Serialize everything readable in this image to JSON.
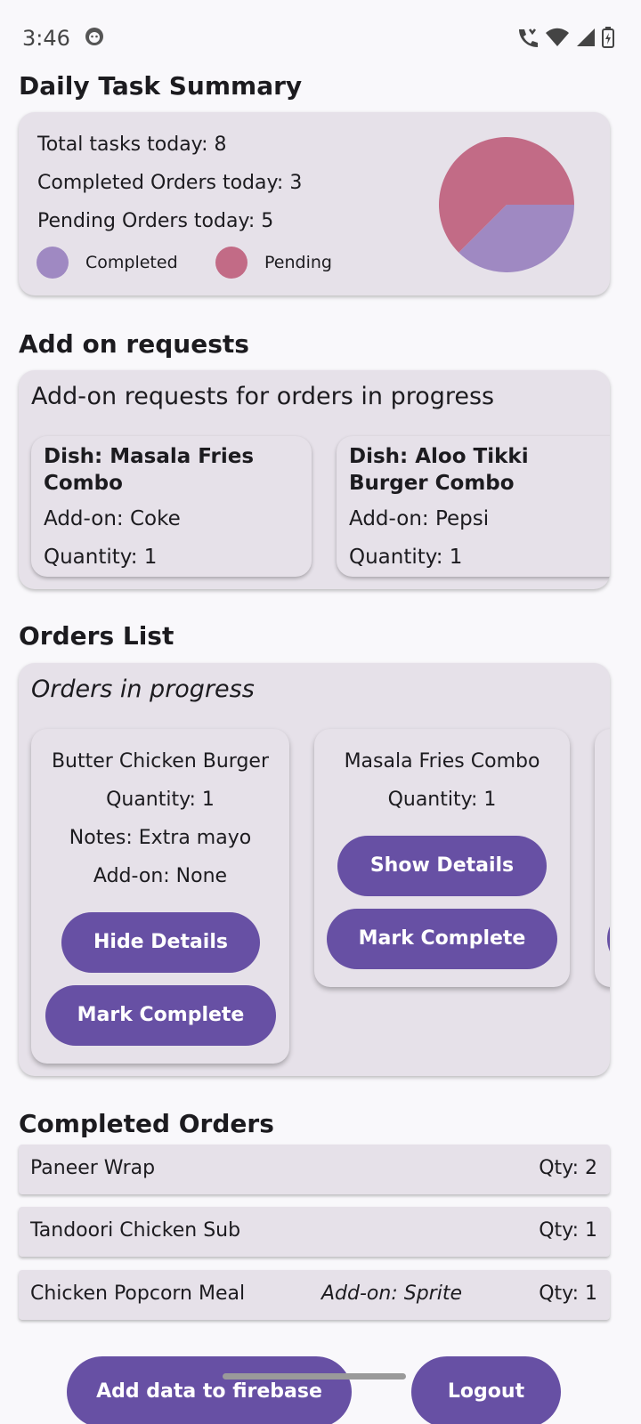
{
  "status_bar": {
    "time": "3:46"
  },
  "summary": {
    "title": "Daily Task Summary",
    "total": "Total tasks today: 8",
    "completed": "Completed Orders today: 3",
    "pending": "Pending Orders today: 5",
    "legend_completed": "Completed",
    "legend_pending": "Pending",
    "colors": {
      "completed": "#9f89c2",
      "pending": "#c26b86"
    }
  },
  "chart_data": {
    "type": "pie",
    "categories": [
      "Completed",
      "Pending"
    ],
    "values": [
      3,
      5
    ]
  },
  "addons": {
    "title": "Add on requests",
    "header": "Add-on requests for orders in progress",
    "items": [
      {
        "dish": "Dish: Masala Fries Combo",
        "addon": "Add-on: Coke",
        "qty": "Quantity: 1"
      },
      {
        "dish": "Dish: Aloo Tikki Burger Combo",
        "addon": "Add-on: Pepsi",
        "qty": "Quantity: 1"
      }
    ]
  },
  "orders": {
    "title": "Orders List",
    "header": "Orders in progress",
    "items": [
      {
        "name": "Butter Chicken Burger",
        "qty": "Quantity: 1",
        "notes": "Notes: Extra mayo",
        "addon": "Add-on: None",
        "details_btn": "Hide Details",
        "complete_btn": "Mark Complete"
      },
      {
        "name": "Masala Fries Combo",
        "qty": "Quantity: 1",
        "details_btn": "Show Details",
        "complete_btn": "Mark Complete"
      }
    ]
  },
  "completed": {
    "title": "Completed Orders",
    "items": [
      {
        "name": "Paneer Wrap",
        "addon": "",
        "qty": "Qty: 2"
      },
      {
        "name": "Tandoori Chicken Sub",
        "addon": "",
        "qty": "Qty: 1"
      },
      {
        "name": "Chicken Popcorn Meal",
        "addon": "Add-on: Sprite",
        "qty": "Qty: 1"
      }
    ]
  },
  "bottom": {
    "add_data": "Add data to firebase",
    "logout": "Logout"
  }
}
